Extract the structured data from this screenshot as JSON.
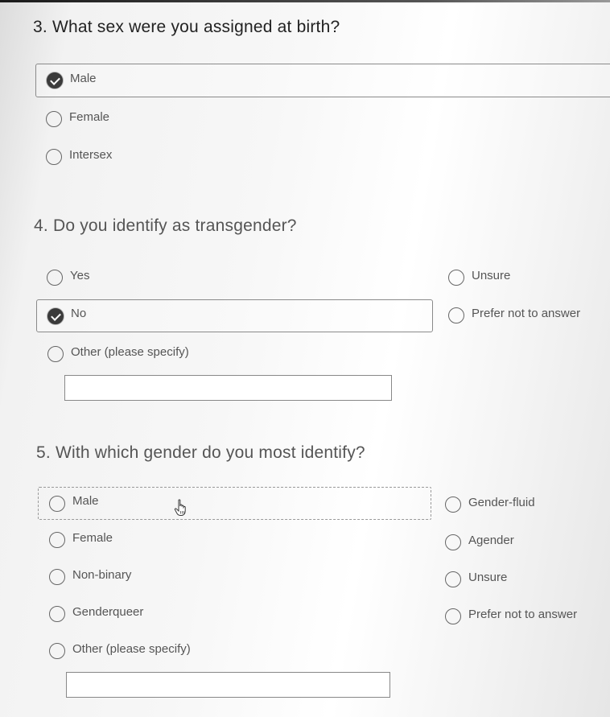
{
  "questions": {
    "q3": {
      "title": "3. What sex were you assigned at birth?",
      "options": [
        {
          "label": "Male",
          "checked": true
        },
        {
          "label": "Female",
          "checked": false
        },
        {
          "label": "Intersex",
          "checked": false
        }
      ]
    },
    "q4": {
      "title": "4. Do you identify as transgender?",
      "options": [
        {
          "label": "Yes",
          "checked": false
        },
        {
          "label": "No",
          "checked": true
        },
        {
          "label": "Other (please specify)",
          "checked": false
        },
        {
          "label": "Unsure",
          "checked": false
        },
        {
          "label": "Prefer not to answer",
          "checked": false
        }
      ],
      "other_value": ""
    },
    "q5": {
      "title": "5. With which gender do you most identify?",
      "options": [
        {
          "label": "Male",
          "checked": false
        },
        {
          "label": "Female",
          "checked": false
        },
        {
          "label": "Non-binary",
          "checked": false
        },
        {
          "label": "Genderqueer",
          "checked": false
        },
        {
          "label": "Other (please specify)",
          "checked": false
        },
        {
          "label": "Gender-fluid",
          "checked": false
        },
        {
          "label": "Agender",
          "checked": false
        },
        {
          "label": "Unsure",
          "checked": false
        },
        {
          "label": "Prefer not to answer",
          "checked": false
        }
      ],
      "other_value": ""
    }
  },
  "icons": {
    "checked_radio": "check-circle-icon",
    "unchecked_radio": "empty-circle-icon",
    "cursor": "hand-pointer-icon"
  }
}
